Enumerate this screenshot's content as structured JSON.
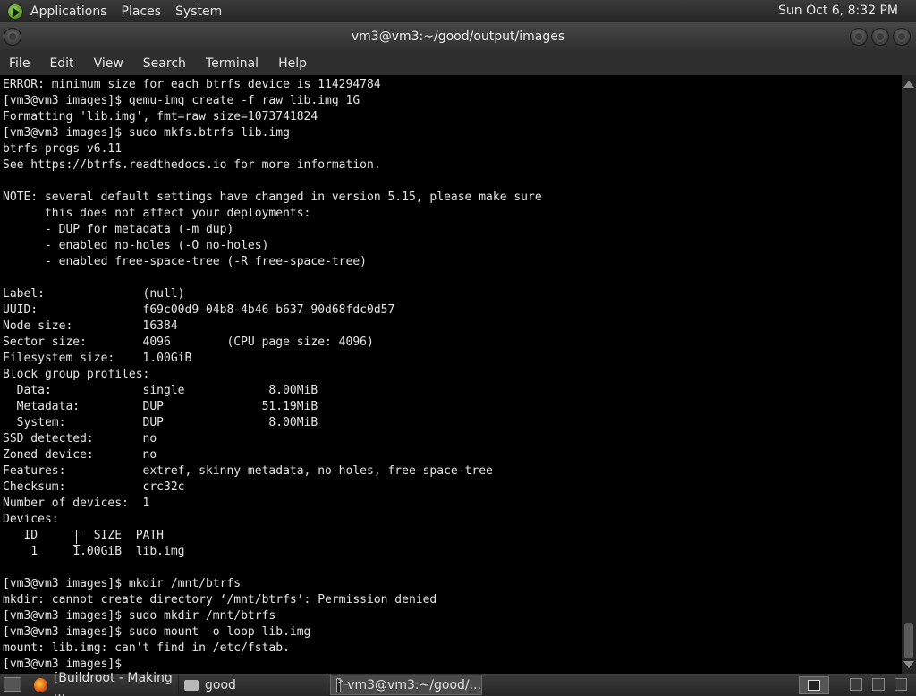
{
  "panel": {
    "menus": [
      "Applications",
      "Places",
      "System"
    ],
    "clock": "Sun Oct  6,  8:32 PM"
  },
  "window": {
    "title": "vm3@vm3:~/good/output/images"
  },
  "menubar": [
    "File",
    "Edit",
    "View",
    "Search",
    "Terminal",
    "Help"
  ],
  "terminal": {
    "lines": [
      "ERROR: minimum size for each btrfs device is 114294784",
      "[vm3@vm3 images]$ qemu-img create -f raw lib.img 1G",
      "Formatting 'lib.img', fmt=raw size=1073741824",
      "[vm3@vm3 images]$ sudo mkfs.btrfs lib.img",
      "btrfs-progs v6.11",
      "See https://btrfs.readthedocs.io for more information.",
      "",
      "NOTE: several default settings have changed in version 5.15, please make sure",
      "      this does not affect your deployments:",
      "      - DUP for metadata (-m dup)",
      "      - enabled no-holes (-O no-holes)",
      "      - enabled free-space-tree (-R free-space-tree)",
      "",
      "Label:              (null)",
      "UUID:               f69c00d9-04b8-4b46-b637-90d68fdc0d57",
      "Node size:          16384",
      "Sector size:        4096        (CPU page size: 4096)",
      "Filesystem size:    1.00GiB",
      "Block group profiles:",
      "  Data:             single            8.00MiB",
      "  Metadata:         DUP              51.19MiB",
      "  System:           DUP               8.00MiB",
      "SSD detected:       no",
      "Zoned device:       no",
      "Features:           extref, skinny-metadata, no-holes, free-space-tree",
      "Checksum:           crc32c",
      "Number of devices:  1",
      "Devices:",
      "   ID        SIZE  PATH",
      "    1     1.00GiB  lib.img",
      "",
      "[vm3@vm3 images]$ mkdir /mnt/btrfs",
      "mkdir: cannot create directory ‘/mnt/btrfs’: Permission denied",
      "[vm3@vm3 images]$ sudo mkdir /mnt/btrfs",
      "[vm3@vm3 images]$ sudo mount -o loop lib.img",
      "mount: lib.img: can't find in /etc/fstab.",
      "[vm3@vm3 images]$ "
    ]
  },
  "taskbar": {
    "tasks": [
      {
        "label": "[Buildroot - Making ...",
        "icon": "firefox-icon"
      },
      {
        "label": "good",
        "icon": "folder-icon"
      },
      {
        "label": "vm3@vm3:~/good/...",
        "icon": "terminal-icon"
      }
    ]
  }
}
